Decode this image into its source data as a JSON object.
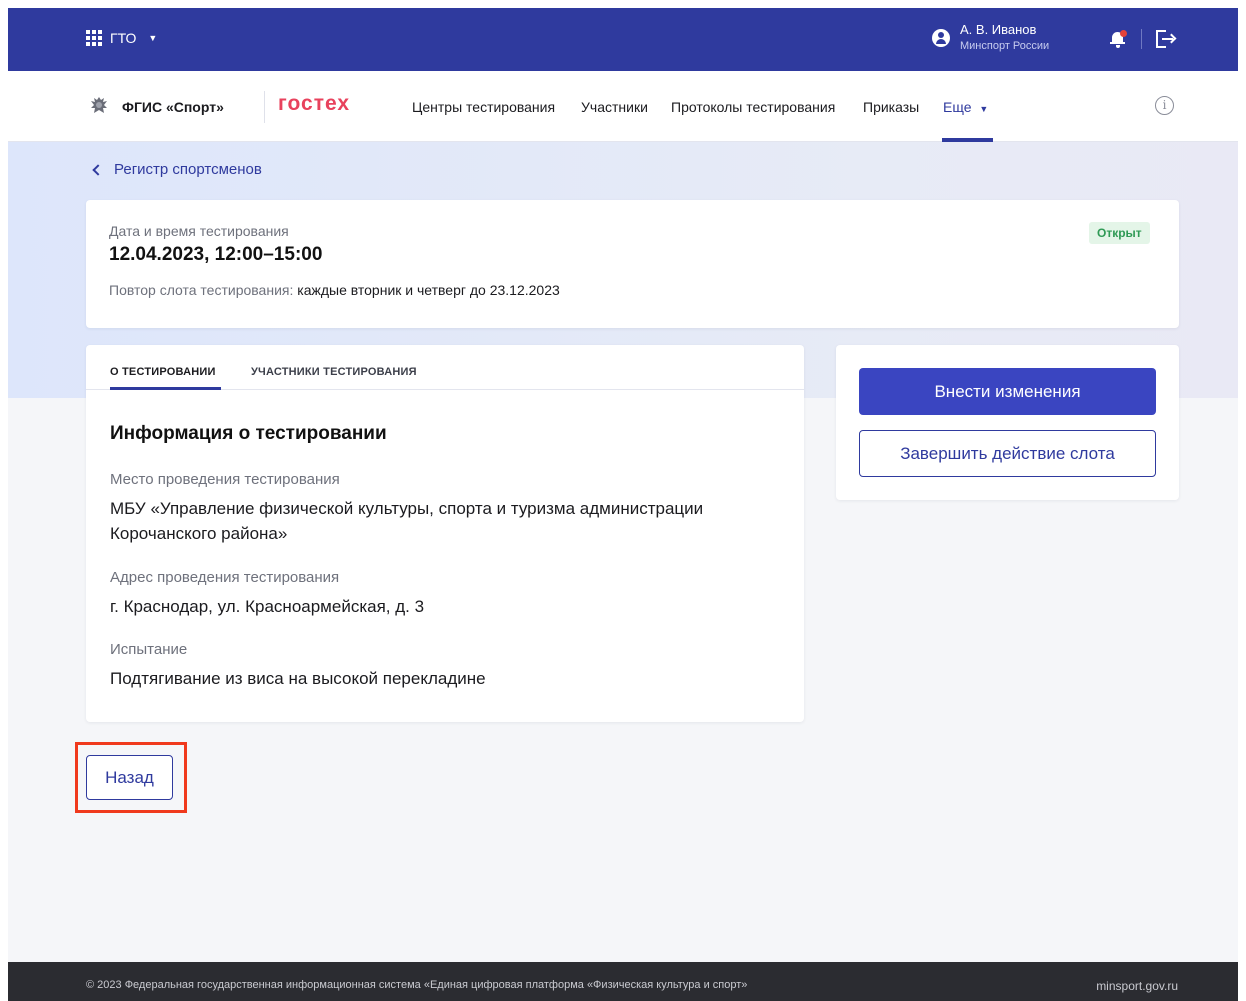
{
  "topbar": {
    "app_name": "ГТО",
    "app_icon": "apps-grid-icon",
    "user_name": "А. В. Иванов",
    "user_org": "Минспорт России",
    "bell_icon": "bell-icon",
    "logout_icon": "logout-icon",
    "bg_color": "#2f3a9e"
  },
  "nav": {
    "brand": "ФГИС «Спорт»",
    "gostech": "гостех",
    "items": [
      "Центры тестирования",
      "Участники",
      "Протоколы тестирования",
      "Приказы"
    ],
    "more": "Еще",
    "info_symbol": "i"
  },
  "breadcrumb": {
    "back_label": "Регистр спортсменов"
  },
  "slot": {
    "label": "Дата и время тестирования",
    "datetime": "12.04.2023, 12:00–15:00",
    "repeat_label": "Повтор слота тестирования:",
    "repeat_value": "каждые вторник и четверг до 23.12.2023",
    "status": "Открыт",
    "status_color": "#2f9a55"
  },
  "tabs": [
    "О ТЕСТИРОВАНИИ",
    "УЧАСТНИКИ ТЕСТИРОВАНИЯ"
  ],
  "info": {
    "title": "Информация о тестировании",
    "place_label": "Место проведения тестирования",
    "place_value": "МБУ «Управление физической культуры, спорта и туризма администрации Корочанского района»",
    "address_label": "Адрес проведения тестирования",
    "address_value": "г. Краснодар, ул. Красноармейская, д. 3",
    "test_label": "Испытание",
    "test_value": "Подтягивание из виса на высокой перекладине"
  },
  "actions": {
    "edit": "Внести изменения",
    "finish": "Завершить действие слота"
  },
  "back_button": "Назад",
  "footer": {
    "copyright": "© 2023 Федеральная государственная информационная система «Единая цифровая платформа «Физическая культура и спорт»",
    "site": "minsport.gov.ru"
  }
}
